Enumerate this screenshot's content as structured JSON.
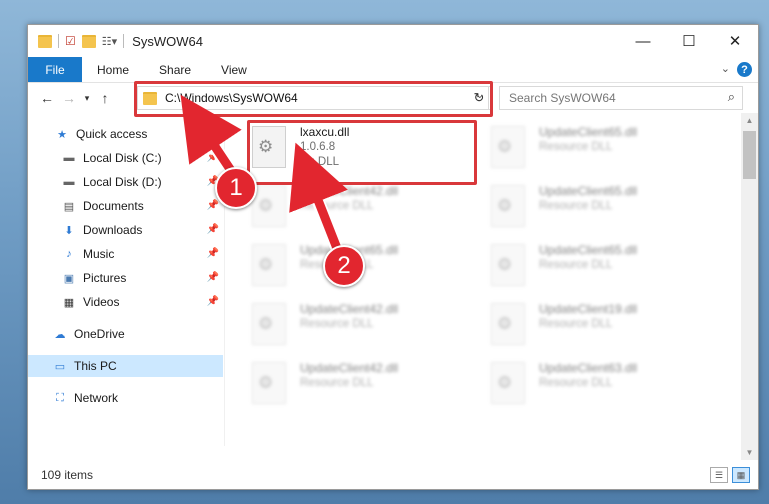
{
  "window": {
    "title": "SysWOW64",
    "controls": {
      "minimize": "—",
      "maximize": "☐",
      "close": "✕"
    }
  },
  "ribbon": {
    "tabs": [
      "File",
      "Home",
      "Share",
      "View"
    ],
    "help": "?"
  },
  "navigation": {
    "address_path": "C:\\Windows\\SysWOW64",
    "search_placeholder": "Search SysWOW64"
  },
  "sidebar": {
    "items": [
      {
        "label": "Quick access",
        "icon": "star-icon"
      },
      {
        "label": "Local Disk (C:)",
        "icon": "drive-icon",
        "pinned": true
      },
      {
        "label": "Local Disk (D:)",
        "icon": "drive-icon",
        "pinned": true
      },
      {
        "label": "Documents",
        "icon": "document-icon",
        "pinned": true
      },
      {
        "label": "Downloads",
        "icon": "download-icon",
        "pinned": true
      },
      {
        "label": "Music",
        "icon": "music-icon",
        "pinned": true
      },
      {
        "label": "Pictures",
        "icon": "pictures-icon",
        "pinned": true
      },
      {
        "label": "Videos",
        "icon": "video-icon",
        "pinned": true
      },
      {
        "label": "OneDrive",
        "icon": "cloud-icon"
      },
      {
        "label": "This PC",
        "icon": "computer-icon",
        "selected": true
      },
      {
        "label": "Network",
        "icon": "network-icon"
      }
    ]
  },
  "files": [
    {
      "name": "lxaxcu.dll",
      "version": "1.0.6.8",
      "type": "Cu DLL"
    },
    {
      "name": "UpdateClient65.dll",
      "type": "Resource DLL"
    },
    {
      "name": "UpdateClient42.dll",
      "type": "Resource DLL"
    },
    {
      "name": "UpdateClient65.dll",
      "type": "Resource DLL"
    },
    {
      "name": "UpdateClient65.dll",
      "type": "Resource DLL"
    },
    {
      "name": "UpdateClient65.dll",
      "type": "Resource DLL"
    },
    {
      "name": "UpdateClient42.dll",
      "type": "Resource DLL"
    },
    {
      "name": "UpdateClient19.dll",
      "type": "Resource DLL"
    },
    {
      "name": "UpdateClient42.dll",
      "type": "Resource DLL"
    },
    {
      "name": "UpdateClient63.dll",
      "type": "Resource DLL"
    }
  ],
  "status": {
    "item_count": "109 items"
  },
  "annotations": {
    "step1": "1",
    "step2": "2"
  },
  "colors": {
    "accent": "#1979ca",
    "highlight": "#d9383b",
    "badge": "#e2262f",
    "selected_bg": "#cce8ff"
  }
}
